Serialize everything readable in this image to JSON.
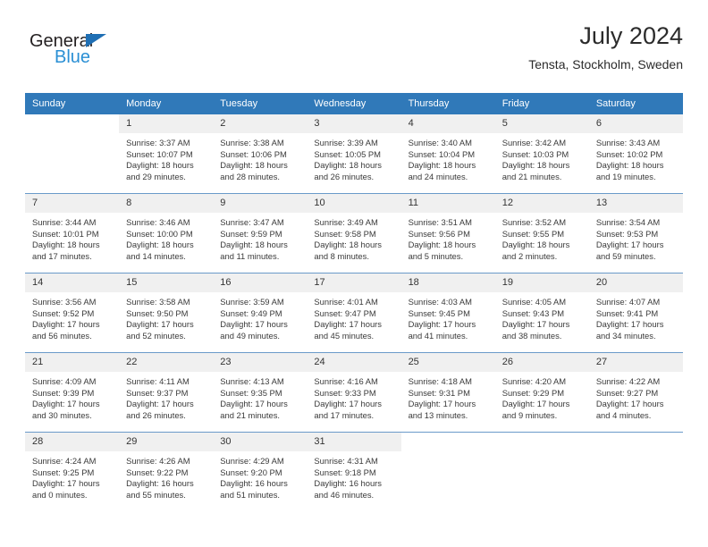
{
  "brand": {
    "name_top": "General",
    "name_bottom": "Blue",
    "accent_color": "#1f6fb4",
    "blue_text_color": "#2a8fd4"
  },
  "header": {
    "month_title": "July 2024",
    "location": "Tensta, Stockholm, Sweden"
  },
  "colors": {
    "header_row": "#3079b9",
    "day_number_band": "#f0f0f0",
    "week_separator": "#6a9ac9",
    "body_text": "#3a3a3a"
  },
  "weekday_headers": [
    "Sunday",
    "Monday",
    "Tuesday",
    "Wednesday",
    "Thursday",
    "Friday",
    "Saturday"
  ],
  "weeks": [
    [
      {
        "day": "",
        "blank": true,
        "sunrise": "",
        "sunset": "",
        "daylight_line1": "",
        "daylight_line2": ""
      },
      {
        "day": "1",
        "sunrise": "Sunrise: 3:37 AM",
        "sunset": "Sunset: 10:07 PM",
        "daylight_line1": "Daylight: 18 hours",
        "daylight_line2": "and 29 minutes."
      },
      {
        "day": "2",
        "sunrise": "Sunrise: 3:38 AM",
        "sunset": "Sunset: 10:06 PM",
        "daylight_line1": "Daylight: 18 hours",
        "daylight_line2": "and 28 minutes."
      },
      {
        "day": "3",
        "sunrise": "Sunrise: 3:39 AM",
        "sunset": "Sunset: 10:05 PM",
        "daylight_line1": "Daylight: 18 hours",
        "daylight_line2": "and 26 minutes."
      },
      {
        "day": "4",
        "sunrise": "Sunrise: 3:40 AM",
        "sunset": "Sunset: 10:04 PM",
        "daylight_line1": "Daylight: 18 hours",
        "daylight_line2": "and 24 minutes."
      },
      {
        "day": "5",
        "sunrise": "Sunrise: 3:42 AM",
        "sunset": "Sunset: 10:03 PM",
        "daylight_line1": "Daylight: 18 hours",
        "daylight_line2": "and 21 minutes."
      },
      {
        "day": "6",
        "sunrise": "Sunrise: 3:43 AM",
        "sunset": "Sunset: 10:02 PM",
        "daylight_line1": "Daylight: 18 hours",
        "daylight_line2": "and 19 minutes."
      }
    ],
    [
      {
        "day": "7",
        "sunrise": "Sunrise: 3:44 AM",
        "sunset": "Sunset: 10:01 PM",
        "daylight_line1": "Daylight: 18 hours",
        "daylight_line2": "and 17 minutes."
      },
      {
        "day": "8",
        "sunrise": "Sunrise: 3:46 AM",
        "sunset": "Sunset: 10:00 PM",
        "daylight_line1": "Daylight: 18 hours",
        "daylight_line2": "and 14 minutes."
      },
      {
        "day": "9",
        "sunrise": "Sunrise: 3:47 AM",
        "sunset": "Sunset: 9:59 PM",
        "daylight_line1": "Daylight: 18 hours",
        "daylight_line2": "and 11 minutes."
      },
      {
        "day": "10",
        "sunrise": "Sunrise: 3:49 AM",
        "sunset": "Sunset: 9:58 PM",
        "daylight_line1": "Daylight: 18 hours",
        "daylight_line2": "and 8 minutes."
      },
      {
        "day": "11",
        "sunrise": "Sunrise: 3:51 AM",
        "sunset": "Sunset: 9:56 PM",
        "daylight_line1": "Daylight: 18 hours",
        "daylight_line2": "and 5 minutes."
      },
      {
        "day": "12",
        "sunrise": "Sunrise: 3:52 AM",
        "sunset": "Sunset: 9:55 PM",
        "daylight_line1": "Daylight: 18 hours",
        "daylight_line2": "and 2 minutes."
      },
      {
        "day": "13",
        "sunrise": "Sunrise: 3:54 AM",
        "sunset": "Sunset: 9:53 PM",
        "daylight_line1": "Daylight: 17 hours",
        "daylight_line2": "and 59 minutes."
      }
    ],
    [
      {
        "day": "14",
        "sunrise": "Sunrise: 3:56 AM",
        "sunset": "Sunset: 9:52 PM",
        "daylight_line1": "Daylight: 17 hours",
        "daylight_line2": "and 56 minutes."
      },
      {
        "day": "15",
        "sunrise": "Sunrise: 3:58 AM",
        "sunset": "Sunset: 9:50 PM",
        "daylight_line1": "Daylight: 17 hours",
        "daylight_line2": "and 52 minutes."
      },
      {
        "day": "16",
        "sunrise": "Sunrise: 3:59 AM",
        "sunset": "Sunset: 9:49 PM",
        "daylight_line1": "Daylight: 17 hours",
        "daylight_line2": "and 49 minutes."
      },
      {
        "day": "17",
        "sunrise": "Sunrise: 4:01 AM",
        "sunset": "Sunset: 9:47 PM",
        "daylight_line1": "Daylight: 17 hours",
        "daylight_line2": "and 45 minutes."
      },
      {
        "day": "18",
        "sunrise": "Sunrise: 4:03 AM",
        "sunset": "Sunset: 9:45 PM",
        "daylight_line1": "Daylight: 17 hours",
        "daylight_line2": "and 41 minutes."
      },
      {
        "day": "19",
        "sunrise": "Sunrise: 4:05 AM",
        "sunset": "Sunset: 9:43 PM",
        "daylight_line1": "Daylight: 17 hours",
        "daylight_line2": "and 38 minutes."
      },
      {
        "day": "20",
        "sunrise": "Sunrise: 4:07 AM",
        "sunset": "Sunset: 9:41 PM",
        "daylight_line1": "Daylight: 17 hours",
        "daylight_line2": "and 34 minutes."
      }
    ],
    [
      {
        "day": "21",
        "sunrise": "Sunrise: 4:09 AM",
        "sunset": "Sunset: 9:39 PM",
        "daylight_line1": "Daylight: 17 hours",
        "daylight_line2": "and 30 minutes."
      },
      {
        "day": "22",
        "sunrise": "Sunrise: 4:11 AM",
        "sunset": "Sunset: 9:37 PM",
        "daylight_line1": "Daylight: 17 hours",
        "daylight_line2": "and 26 minutes."
      },
      {
        "day": "23",
        "sunrise": "Sunrise: 4:13 AM",
        "sunset": "Sunset: 9:35 PM",
        "daylight_line1": "Daylight: 17 hours",
        "daylight_line2": "and 21 minutes."
      },
      {
        "day": "24",
        "sunrise": "Sunrise: 4:16 AM",
        "sunset": "Sunset: 9:33 PM",
        "daylight_line1": "Daylight: 17 hours",
        "daylight_line2": "and 17 minutes."
      },
      {
        "day": "25",
        "sunrise": "Sunrise: 4:18 AM",
        "sunset": "Sunset: 9:31 PM",
        "daylight_line1": "Daylight: 17 hours",
        "daylight_line2": "and 13 minutes."
      },
      {
        "day": "26",
        "sunrise": "Sunrise: 4:20 AM",
        "sunset": "Sunset: 9:29 PM",
        "daylight_line1": "Daylight: 17 hours",
        "daylight_line2": "and 9 minutes."
      },
      {
        "day": "27",
        "sunrise": "Sunrise: 4:22 AM",
        "sunset": "Sunset: 9:27 PM",
        "daylight_line1": "Daylight: 17 hours",
        "daylight_line2": "and 4 minutes."
      }
    ],
    [
      {
        "day": "28",
        "sunrise": "Sunrise: 4:24 AM",
        "sunset": "Sunset: 9:25 PM",
        "daylight_line1": "Daylight: 17 hours",
        "daylight_line2": "and 0 minutes."
      },
      {
        "day": "29",
        "sunrise": "Sunrise: 4:26 AM",
        "sunset": "Sunset: 9:22 PM",
        "daylight_line1": "Daylight: 16 hours",
        "daylight_line2": "and 55 minutes."
      },
      {
        "day": "30",
        "sunrise": "Sunrise: 4:29 AM",
        "sunset": "Sunset: 9:20 PM",
        "daylight_line1": "Daylight: 16 hours",
        "daylight_line2": "and 51 minutes."
      },
      {
        "day": "31",
        "sunrise": "Sunrise: 4:31 AM",
        "sunset": "Sunset: 9:18 PM",
        "daylight_line1": "Daylight: 16 hours",
        "daylight_line2": "and 46 minutes."
      },
      {
        "day": "",
        "blank": true,
        "sunrise": "",
        "sunset": "",
        "daylight_line1": "",
        "daylight_line2": ""
      },
      {
        "day": "",
        "blank": true,
        "sunrise": "",
        "sunset": "",
        "daylight_line1": "",
        "daylight_line2": ""
      },
      {
        "day": "",
        "blank": true,
        "sunrise": "",
        "sunset": "",
        "daylight_line1": "",
        "daylight_line2": ""
      }
    ]
  ]
}
